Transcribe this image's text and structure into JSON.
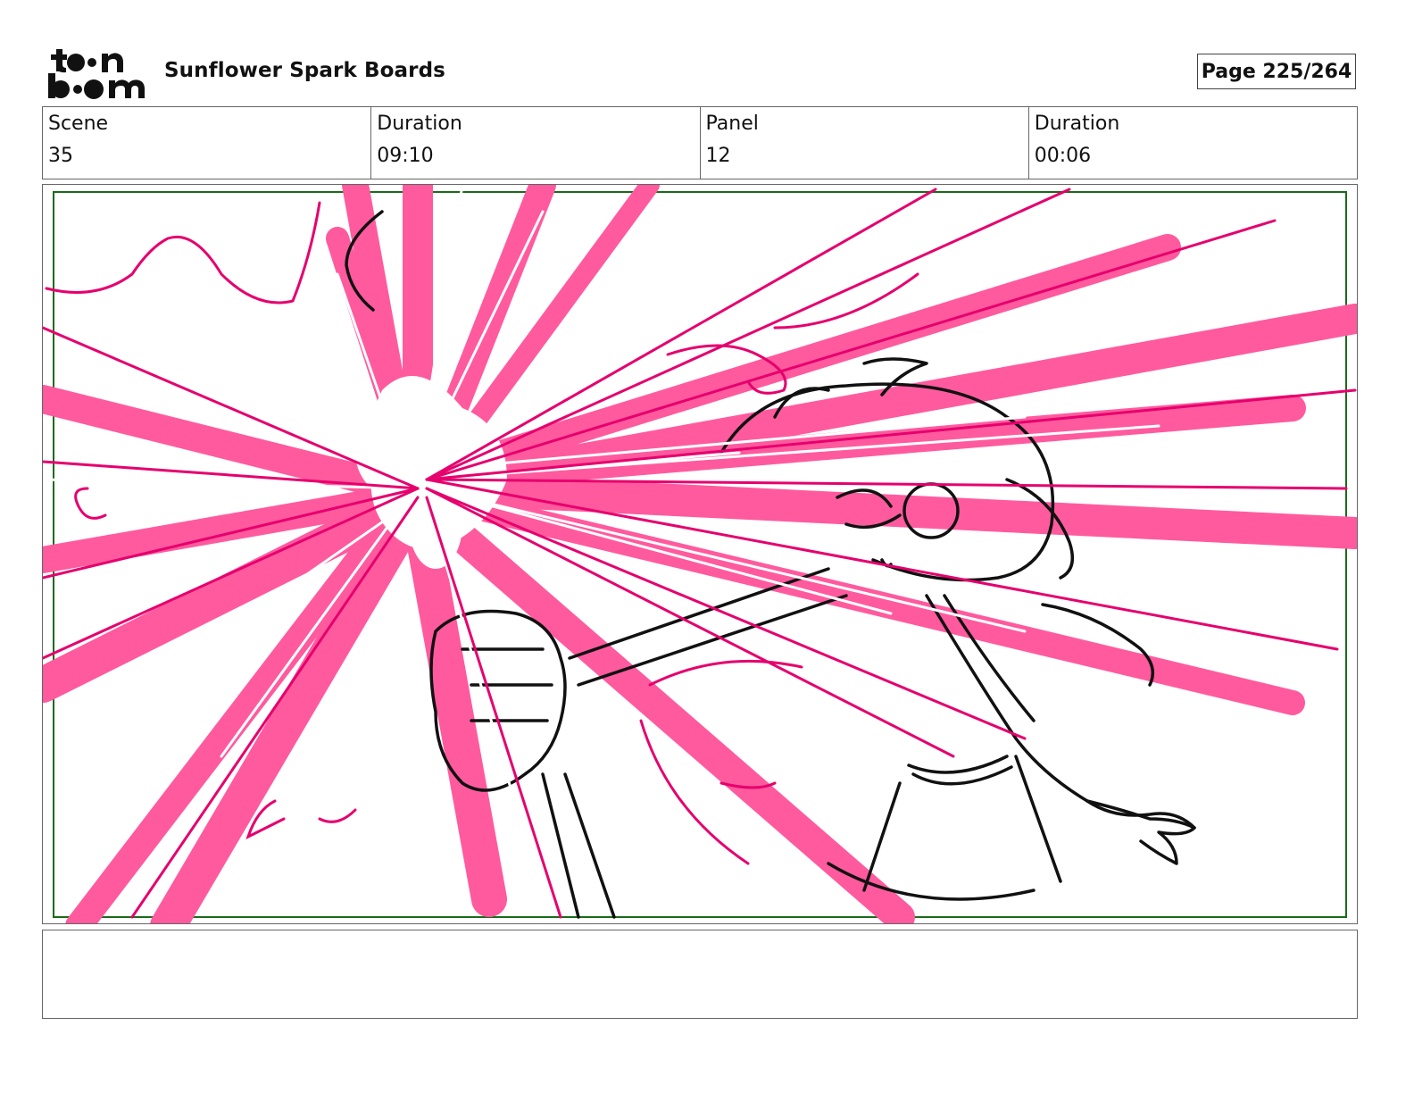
{
  "header": {
    "logo_text": "toon boom",
    "title": "Sunflower Spark Boards",
    "page_label": "Page 225/264"
  },
  "info": [
    {
      "label": "Scene",
      "value": "35"
    },
    {
      "label": "Duration",
      "value": "09:10"
    },
    {
      "label": "Panel",
      "value": "12"
    },
    {
      "label": "Duration",
      "value": "00:06"
    }
  ],
  "panel": {
    "image": "storyboard-sketch",
    "colors": {
      "fx_pink": "#ff5a9e",
      "fx_magenta": "#e6006e",
      "ink": "#111111",
      "safe_frame": "#1a6b1a"
    }
  },
  "notes": {
    "text": ""
  }
}
